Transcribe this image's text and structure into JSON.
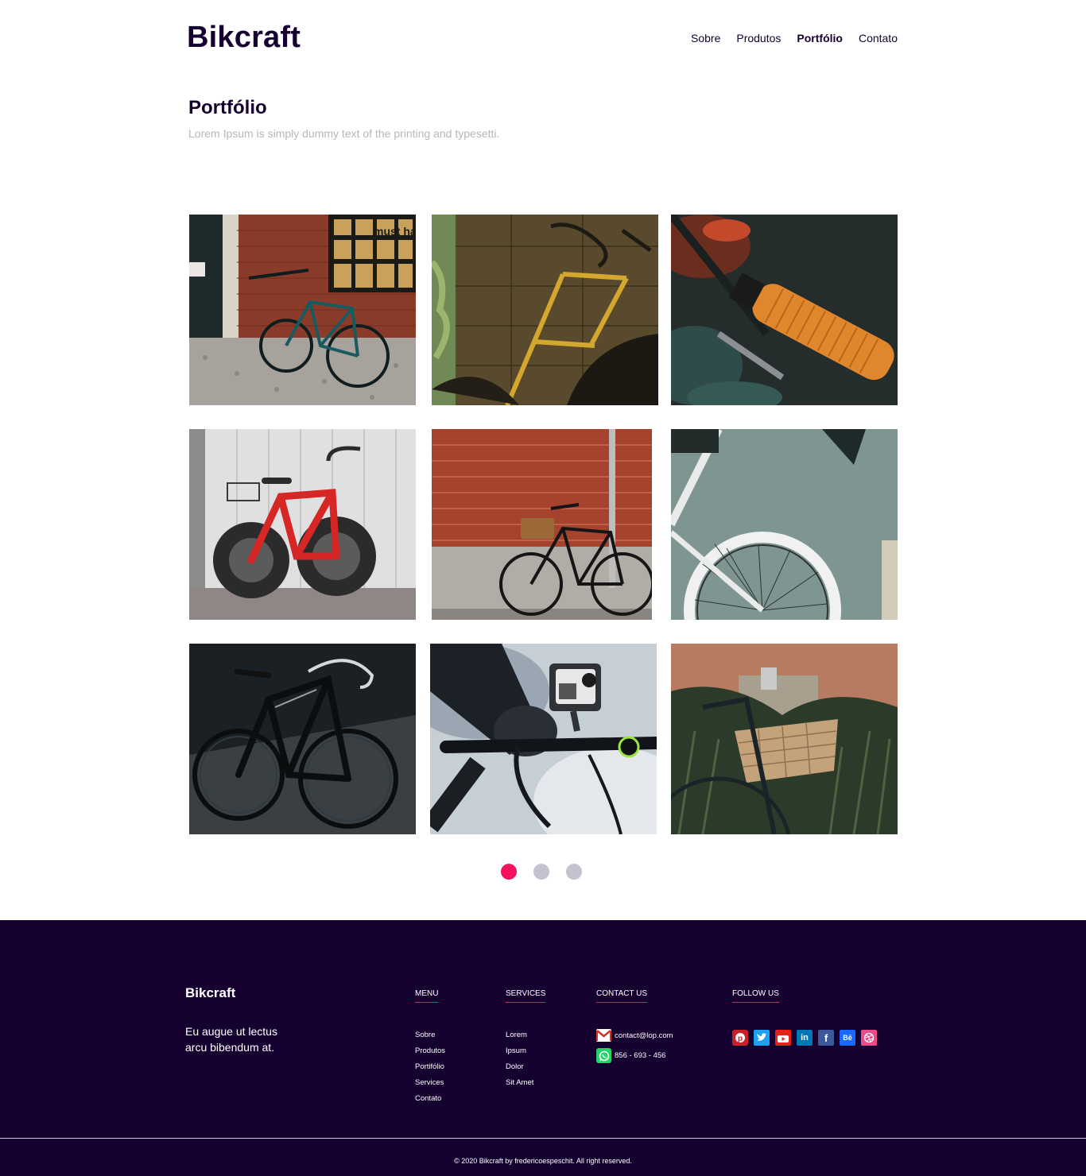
{
  "header": {
    "brand": "Bikcraft",
    "nav": [
      {
        "label": "Sobre"
      },
      {
        "label": "Produtos"
      },
      {
        "label": "Portfólio",
        "active": true
      },
      {
        "label": "Contato"
      }
    ]
  },
  "intro": {
    "title": "Portfólio",
    "subtitle": "Lorem Ipsum is simply dummy text of the printing and typesetti."
  },
  "gallery": {
    "photo_1_sign": "must have"
  },
  "pagination": {
    "active_color": "#f2125f",
    "inactive_color": "#c2c2d1"
  },
  "footer": {
    "brand": "Bikcraft",
    "tagline": "Eu augue ut lectus arcu bibendum at.",
    "menu": {
      "heading": "MENU",
      "items": [
        "Sobre",
        "Produtos",
        "Portifólio",
        "Services",
        "Contato"
      ]
    },
    "services": {
      "heading": "SERVICES",
      "items": [
        "Lorem",
        "Ipsum",
        "Dolor",
        "Sit Amet"
      ]
    },
    "contact": {
      "heading": "CONTACT US",
      "email": "contact@lop.com",
      "phone": "856 - 693 - 456"
    },
    "follow": {
      "heading": "FOLLOW US",
      "icons": [
        {
          "name": "pinterest-icon",
          "color": "#cb2027"
        },
        {
          "name": "twitter-icon",
          "color": "#1da1f2"
        },
        {
          "name": "youtube-icon",
          "color": "#e62117"
        },
        {
          "name": "linkedin-icon",
          "color": "#0077b5"
        },
        {
          "name": "facebook-icon",
          "color": "#3b5998"
        },
        {
          "name": "behance-icon",
          "color": "#1769ff"
        },
        {
          "name": "dribbble-icon",
          "color": "#ea4c89"
        }
      ]
    },
    "copyright": "© 2020 Bikcraft by fredericoespeschit. All right reserved."
  },
  "colors": {
    "brand_dark": "#15002f",
    "accent": "#f2125f",
    "muted": "#b6b6bd"
  }
}
